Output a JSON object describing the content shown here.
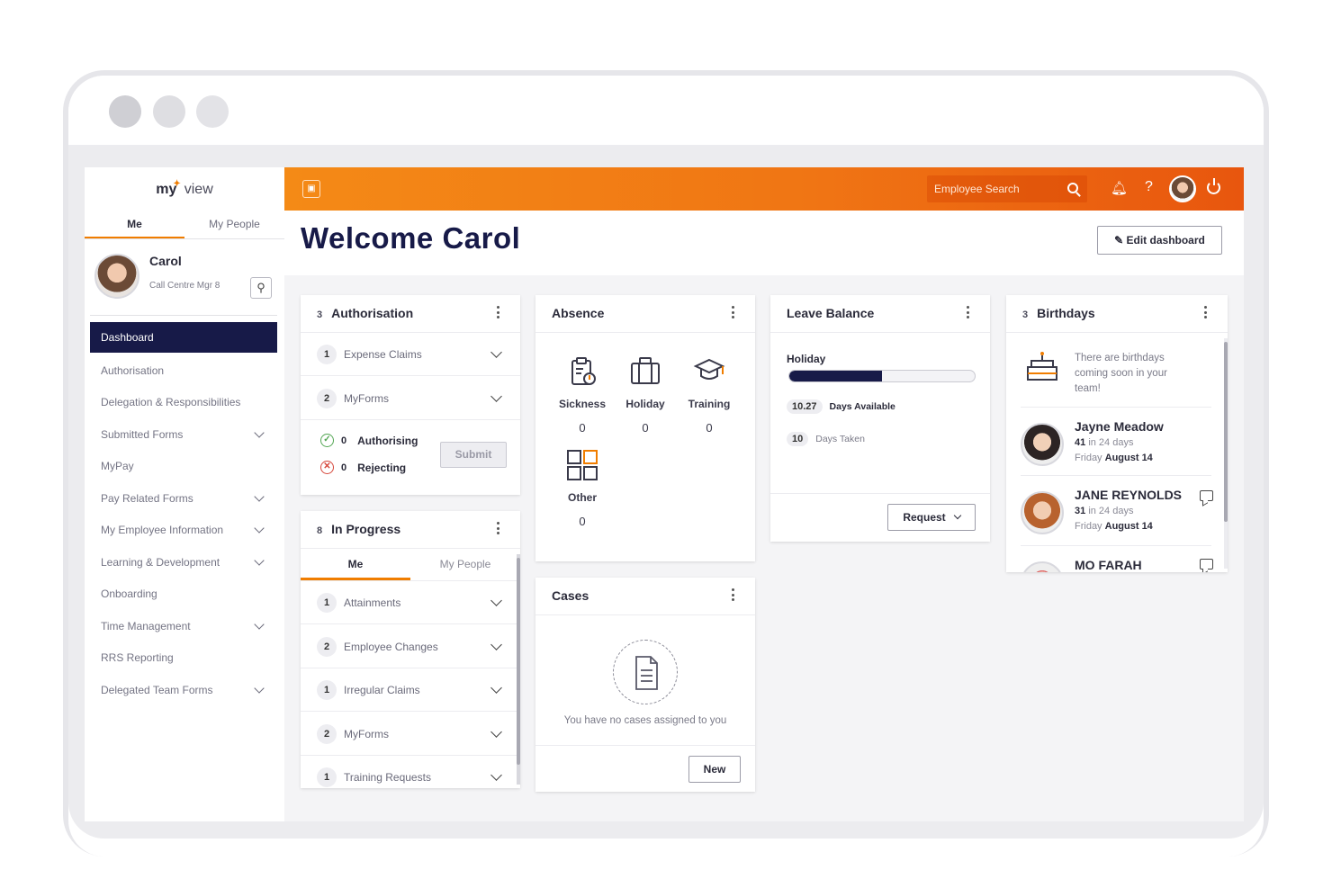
{
  "app": {
    "logo_main": "my",
    "logo_accent": "view"
  },
  "sidebar": {
    "tabs": [
      {
        "label": "Me"
      },
      {
        "label": "My People"
      }
    ],
    "user": {
      "name": "Carol",
      "role": "Call Centre Mgr 8"
    },
    "items": [
      {
        "label": "Dashboard"
      },
      {
        "label": "Authorisation"
      },
      {
        "label": "Delegation & Responsibilities"
      },
      {
        "label": "Submitted Forms"
      },
      {
        "label": "MyPay"
      },
      {
        "label": "Pay Related Forms"
      },
      {
        "label": "My Employee Information"
      },
      {
        "label": "Learning & Development"
      },
      {
        "label": "Onboarding"
      },
      {
        "label": "Time Management"
      },
      {
        "label": "RRS Reporting"
      },
      {
        "label": "Delegated Team Forms"
      }
    ]
  },
  "header": {
    "search_placeholder": "Employee Search",
    "help": "?"
  },
  "main": {
    "welcome": "Welcome Carol",
    "edit_label": "Edit dashboard"
  },
  "authorisation": {
    "count": "3",
    "title": "Authorisation",
    "rows": [
      {
        "count": "1",
        "label": "Expense Claims"
      },
      {
        "count": "2",
        "label": "MyForms"
      }
    ],
    "authorising": {
      "count": "0",
      "label": "Authorising"
    },
    "rejecting": {
      "count": "0",
      "label": "Rejecting"
    },
    "submit_label": "Submit"
  },
  "inprogress": {
    "count": "8",
    "title": "In Progress",
    "tabs": [
      {
        "label": "Me"
      },
      {
        "label": "My People"
      }
    ],
    "rows": [
      {
        "count": "1",
        "label": "Attainments"
      },
      {
        "count": "2",
        "label": "Employee Changes"
      },
      {
        "count": "1",
        "label": "Irregular Claims"
      },
      {
        "count": "2",
        "label": "MyForms"
      },
      {
        "count": "1",
        "label": "Training Requests"
      }
    ]
  },
  "absence": {
    "title": "Absence",
    "items": [
      {
        "label": "Sickness",
        "value": "0"
      },
      {
        "label": "Holiday",
        "value": "0"
      },
      {
        "label": "Training",
        "value": "0"
      },
      {
        "label": "Other",
        "value": "0"
      }
    ]
  },
  "cases": {
    "title": "Cases",
    "empty_text": "You have no cases assigned to you",
    "new_label": "New"
  },
  "leave": {
    "title": "Leave Balance",
    "holiday_label": "Holiday",
    "fill_fraction": 0.5,
    "available": {
      "value": "10.27",
      "label": "Days Available"
    },
    "taken": {
      "value": "10",
      "label": "Days Taken"
    },
    "request_label": "Request"
  },
  "birthdays": {
    "count": "3",
    "title": "Birthdays",
    "intro": "There are birthdays coming soon in your team!",
    "people": [
      {
        "name": "Jayne Meadow",
        "age": "41",
        "in_days": "in 24 days",
        "day": "Friday",
        "date": "August 14"
      },
      {
        "name": "JANE REYNOLDS",
        "age": "31",
        "in_days": "in 24 days",
        "day": "Friday",
        "date": "August 14"
      },
      {
        "name": "MO FARAH"
      }
    ]
  },
  "colors": {
    "accent": "#f07d00",
    "navy": "#171a48",
    "header_start": "#f48a16",
    "header_end": "#e8560e"
  }
}
